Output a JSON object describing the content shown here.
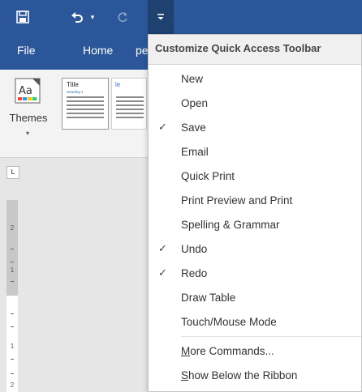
{
  "qat": {
    "save_icon": "save-icon",
    "undo_icon": "undo-icon",
    "redo_icon": "redo-icon",
    "customize_icon": "customize-qat-icon"
  },
  "tabs": {
    "file": "File",
    "home": "Home",
    "partial": "pe"
  },
  "ribbon": {
    "themes_label": "Themes",
    "styleset_title": "Title",
    "styleset_heading": "Heading 1",
    "styleset2_title": "le"
  },
  "ruler": {
    "marks": [
      "2",
      "1",
      "1",
      "2"
    ]
  },
  "menu": {
    "title": "Customize Quick Access Toolbar",
    "items": [
      {
        "label": "New",
        "checked": false
      },
      {
        "label": "Open",
        "checked": false
      },
      {
        "label": "Save",
        "checked": true
      },
      {
        "label": "Email",
        "checked": false
      },
      {
        "label": "Quick Print",
        "checked": false
      },
      {
        "label": "Print Preview and Print",
        "checked": false
      },
      {
        "label": "Spelling & Grammar",
        "checked": false
      },
      {
        "label": "Undo",
        "checked": true
      },
      {
        "label": "Redo",
        "checked": true
      },
      {
        "label": "Draw Table",
        "checked": false
      },
      {
        "label": "Touch/Mouse Mode",
        "checked": false
      }
    ],
    "more_commands": {
      "accel": "M",
      "rest": "ore Commands..."
    },
    "show_below": {
      "accel": "S",
      "rest": "how Below the Ribbon"
    },
    "check_glyph": "✓"
  },
  "colors": {
    "titlebar": "#2b579a",
    "accent_dark": "#1e4170",
    "heading_blue": "#2e74b5"
  }
}
